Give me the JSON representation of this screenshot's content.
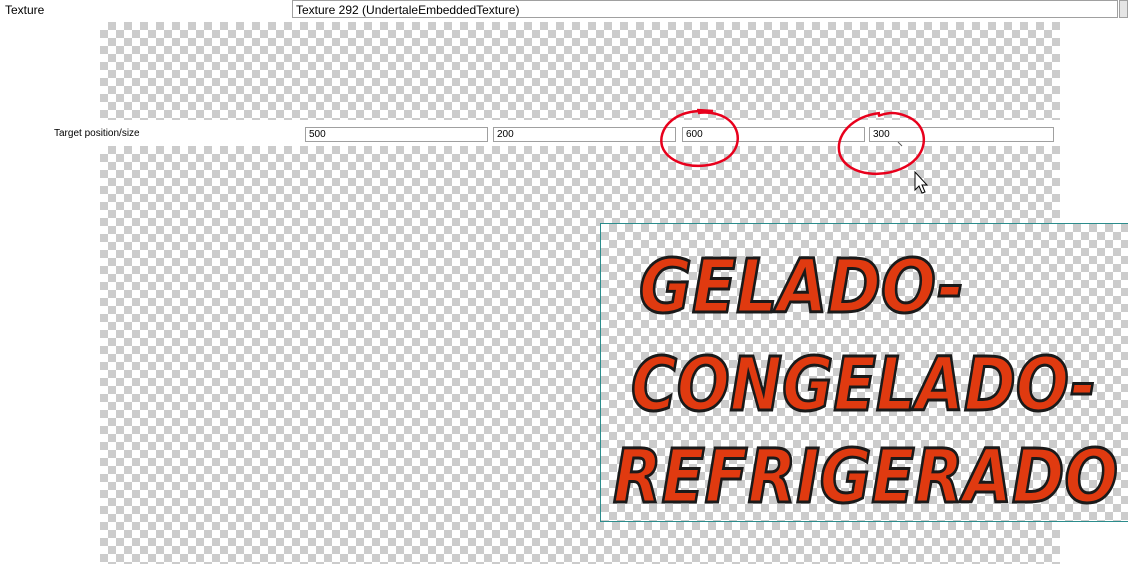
{
  "texture": {
    "label": "Texture",
    "value": "Texture 292 (UndertaleEmbeddedTexture)"
  },
  "target": {
    "label": "Target position/size",
    "x": "500",
    "y": "200",
    "width": "600",
    "height": "300"
  },
  "image": {
    "lines": [
      "GELADO-",
      "CONGELADO-",
      "REFRIGERADO"
    ],
    "text_color": "#e03a10",
    "outline_color": "#1a1a1a"
  },
  "annotations": {
    "circle_color": "#e8001c"
  }
}
